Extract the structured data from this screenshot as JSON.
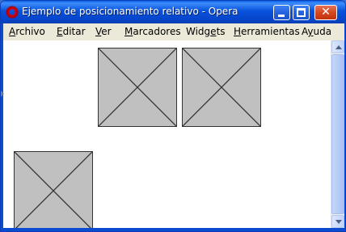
{
  "window": {
    "title": "Ejemplo de posicionamiento relativo - Opera"
  },
  "menu": {
    "items": [
      {
        "pre": "",
        "ul": "A",
        "post": "rchivo"
      },
      {
        "pre": "",
        "ul": "E",
        "post": "ditar"
      },
      {
        "pre": "",
        "ul": "V",
        "post": "er"
      },
      {
        "pre": "",
        "ul": "M",
        "post": "arcadores"
      },
      {
        "pre": "Widg",
        "ul": "e",
        "post": "ts"
      },
      {
        "pre": "",
        "ul": "H",
        "post": "erramientas"
      },
      {
        "pre": "A",
        "ul": "y",
        "post": "uda"
      }
    ]
  },
  "content": {
    "images": [
      {
        "name": "image-placeholder-1"
      },
      {
        "name": "image-placeholder-2"
      },
      {
        "name": "image-placeholder-3"
      }
    ]
  },
  "colors": {
    "titlebar": "#0852dc",
    "placeholder_fill": "#c0c0c0",
    "placeholder_stroke": "#333333"
  }
}
